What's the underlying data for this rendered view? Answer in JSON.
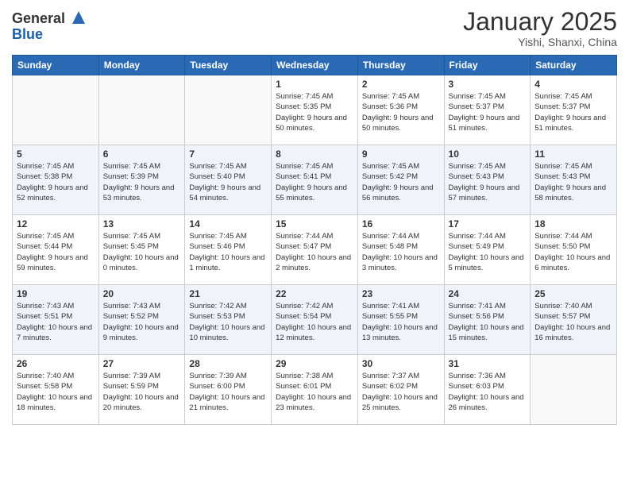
{
  "header": {
    "logo_general": "General",
    "logo_blue": "Blue",
    "month_year": "January 2025",
    "location": "Yishi, Shanxi, China"
  },
  "days_of_week": [
    "Sunday",
    "Monday",
    "Tuesday",
    "Wednesday",
    "Thursday",
    "Friday",
    "Saturday"
  ],
  "weeks": [
    {
      "days": [
        {
          "num": "",
          "info": ""
        },
        {
          "num": "",
          "info": ""
        },
        {
          "num": "",
          "info": ""
        },
        {
          "num": "1",
          "info": "Sunrise: 7:45 AM\nSunset: 5:35 PM\nDaylight: 9 hours and 50 minutes."
        },
        {
          "num": "2",
          "info": "Sunrise: 7:45 AM\nSunset: 5:36 PM\nDaylight: 9 hours and 50 minutes."
        },
        {
          "num": "3",
          "info": "Sunrise: 7:45 AM\nSunset: 5:37 PM\nDaylight: 9 hours and 51 minutes."
        },
        {
          "num": "4",
          "info": "Sunrise: 7:45 AM\nSunset: 5:37 PM\nDaylight: 9 hours and 51 minutes."
        }
      ]
    },
    {
      "days": [
        {
          "num": "5",
          "info": "Sunrise: 7:45 AM\nSunset: 5:38 PM\nDaylight: 9 hours and 52 minutes."
        },
        {
          "num": "6",
          "info": "Sunrise: 7:45 AM\nSunset: 5:39 PM\nDaylight: 9 hours and 53 minutes."
        },
        {
          "num": "7",
          "info": "Sunrise: 7:45 AM\nSunset: 5:40 PM\nDaylight: 9 hours and 54 minutes."
        },
        {
          "num": "8",
          "info": "Sunrise: 7:45 AM\nSunset: 5:41 PM\nDaylight: 9 hours and 55 minutes."
        },
        {
          "num": "9",
          "info": "Sunrise: 7:45 AM\nSunset: 5:42 PM\nDaylight: 9 hours and 56 minutes."
        },
        {
          "num": "10",
          "info": "Sunrise: 7:45 AM\nSunset: 5:43 PM\nDaylight: 9 hours and 57 minutes."
        },
        {
          "num": "11",
          "info": "Sunrise: 7:45 AM\nSunset: 5:43 PM\nDaylight: 9 hours and 58 minutes."
        }
      ]
    },
    {
      "days": [
        {
          "num": "12",
          "info": "Sunrise: 7:45 AM\nSunset: 5:44 PM\nDaylight: 9 hours and 59 minutes."
        },
        {
          "num": "13",
          "info": "Sunrise: 7:45 AM\nSunset: 5:45 PM\nDaylight: 10 hours and 0 minutes."
        },
        {
          "num": "14",
          "info": "Sunrise: 7:45 AM\nSunset: 5:46 PM\nDaylight: 10 hours and 1 minute."
        },
        {
          "num": "15",
          "info": "Sunrise: 7:44 AM\nSunset: 5:47 PM\nDaylight: 10 hours and 2 minutes."
        },
        {
          "num": "16",
          "info": "Sunrise: 7:44 AM\nSunset: 5:48 PM\nDaylight: 10 hours and 3 minutes."
        },
        {
          "num": "17",
          "info": "Sunrise: 7:44 AM\nSunset: 5:49 PM\nDaylight: 10 hours and 5 minutes."
        },
        {
          "num": "18",
          "info": "Sunrise: 7:44 AM\nSunset: 5:50 PM\nDaylight: 10 hours and 6 minutes."
        }
      ]
    },
    {
      "days": [
        {
          "num": "19",
          "info": "Sunrise: 7:43 AM\nSunset: 5:51 PM\nDaylight: 10 hours and 7 minutes."
        },
        {
          "num": "20",
          "info": "Sunrise: 7:43 AM\nSunset: 5:52 PM\nDaylight: 10 hours and 9 minutes."
        },
        {
          "num": "21",
          "info": "Sunrise: 7:42 AM\nSunset: 5:53 PM\nDaylight: 10 hours and 10 minutes."
        },
        {
          "num": "22",
          "info": "Sunrise: 7:42 AM\nSunset: 5:54 PM\nDaylight: 10 hours and 12 minutes."
        },
        {
          "num": "23",
          "info": "Sunrise: 7:41 AM\nSunset: 5:55 PM\nDaylight: 10 hours and 13 minutes."
        },
        {
          "num": "24",
          "info": "Sunrise: 7:41 AM\nSunset: 5:56 PM\nDaylight: 10 hours and 15 minutes."
        },
        {
          "num": "25",
          "info": "Sunrise: 7:40 AM\nSunset: 5:57 PM\nDaylight: 10 hours and 16 minutes."
        }
      ]
    },
    {
      "days": [
        {
          "num": "26",
          "info": "Sunrise: 7:40 AM\nSunset: 5:58 PM\nDaylight: 10 hours and 18 minutes."
        },
        {
          "num": "27",
          "info": "Sunrise: 7:39 AM\nSunset: 5:59 PM\nDaylight: 10 hours and 20 minutes."
        },
        {
          "num": "28",
          "info": "Sunrise: 7:39 AM\nSunset: 6:00 PM\nDaylight: 10 hours and 21 minutes."
        },
        {
          "num": "29",
          "info": "Sunrise: 7:38 AM\nSunset: 6:01 PM\nDaylight: 10 hours and 23 minutes."
        },
        {
          "num": "30",
          "info": "Sunrise: 7:37 AM\nSunset: 6:02 PM\nDaylight: 10 hours and 25 minutes."
        },
        {
          "num": "31",
          "info": "Sunrise: 7:36 AM\nSunset: 6:03 PM\nDaylight: 10 hours and 26 minutes."
        },
        {
          "num": "",
          "info": ""
        }
      ]
    }
  ]
}
